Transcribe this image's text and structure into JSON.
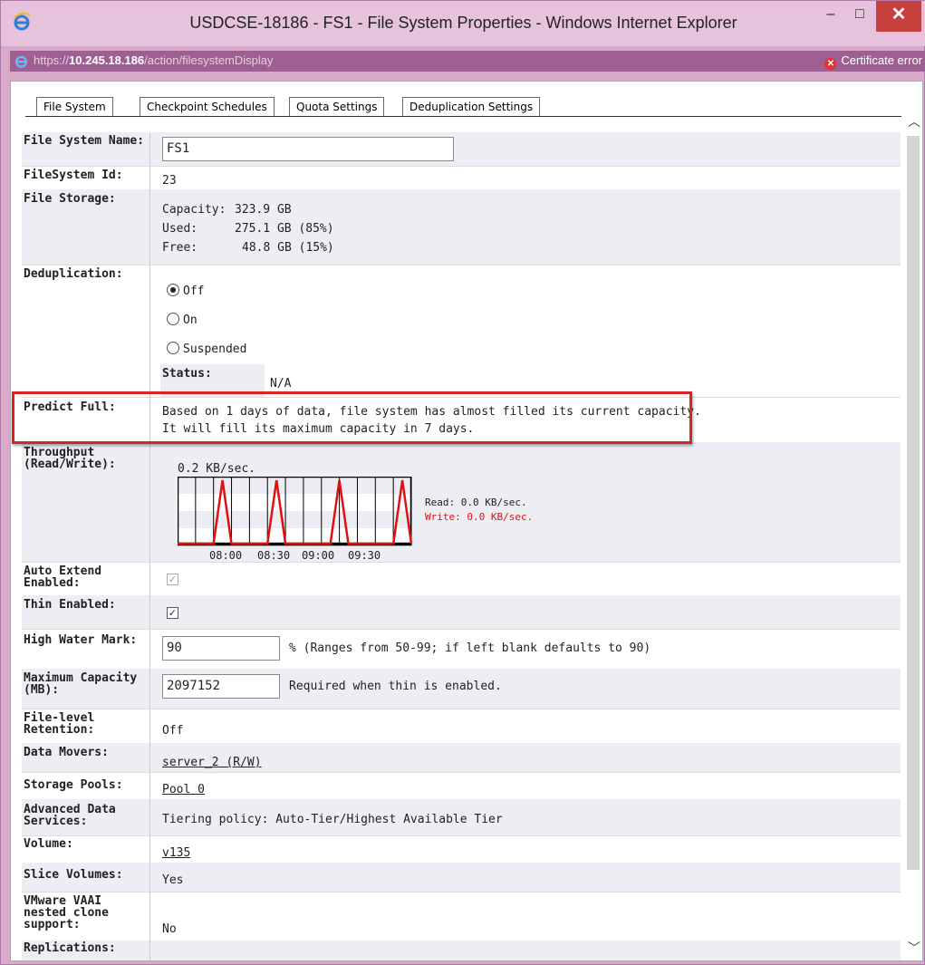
{
  "window": {
    "title": "USDCSE-18186 - FS1 - File System Properties - Windows Internet Explorer",
    "minimize": "–",
    "maximize": "□",
    "close": "✕"
  },
  "address": {
    "prefix": "https://",
    "host": "10.245.18.186",
    "path": "/action/filesystemDisplay",
    "cert_error": "Certificate error"
  },
  "tabs": [
    "File System",
    "Checkpoint Schedules",
    "Quota Settings",
    "Deduplication Settings"
  ],
  "fields": {
    "fs_name_label": "File System Name:",
    "fs_name_value": "FS1",
    "fs_id_label": "FileSystem Id:",
    "fs_id_value": "23",
    "storage_label": "File Storage:",
    "capacity_label": "Capacity:",
    "capacity_value": "323.9 GB",
    "used_label": "Used:",
    "used_value": "275.1 GB (85%)",
    "free_label": "Free:",
    "free_value": "48.8 GB (15%)",
    "dedup_label": "Deduplication:",
    "dedup_options": [
      "Off",
      "On",
      "Suspended"
    ],
    "dedup_selected": "Off",
    "status_label": "Status:",
    "status_value": "N/A",
    "predict_label": "Predict Full:",
    "predict_line1": "Based on 1 days of data, file system has almost filled its current capacity.",
    "predict_line2": "It will fill its maximum capacity in 7 days.",
    "throughput_label": "Throughput (Read/Write):",
    "throughput_value": "0.2 KB/sec.",
    "read_text": "Read:  0.0 KB/sec.",
    "write_text": "Write: 0.0 KB/sec.",
    "auto_extend_label": "Auto Extend Enabled:",
    "thin_label": "Thin Enabled:",
    "hwm_label": "High Water Mark:",
    "hwm_value": "90",
    "hwm_hint": "% (Ranges from 50-99; if left blank defaults to 90)",
    "maxcap_label": "Maximum Capacity (MB):",
    "maxcap_value": "2097152",
    "maxcap_hint": "Required when thin is enabled.",
    "retention_label": "File-level Retention:",
    "retention_value": "Off",
    "movers_label": "Data Movers:",
    "movers_value": "server_2 (R/W)",
    "pools_label": "Storage Pools:",
    "pools_value": "Pool 0",
    "ads_label": "Advanced Data Services:",
    "ads_value": "Tiering policy: Auto-Tier/Highest Available Tier",
    "volume_label": "Volume:",
    "volume_value": "v135",
    "slice_label": "Slice Volumes:",
    "slice_value": "Yes",
    "vaai_label": "VMware VAAI nested clone support:",
    "vaai_value": "No",
    "repl_label": "Replications:"
  },
  "chart_data": {
    "type": "line",
    "x_ticks": [
      "08:00",
      "08:30",
      "09:00",
      "09:30"
    ],
    "series": [
      {
        "name": "Read",
        "color": "#000000",
        "values": [
          0,
          0,
          0,
          0,
          0,
          0,
          0,
          0,
          0,
          0,
          0,
          0,
          0,
          0,
          0,
          0,
          0,
          0,
          0,
          0,
          0,
          0,
          0,
          0,
          0
        ]
      },
      {
        "name": "Write",
        "color": "#e01010",
        "values": [
          0,
          0,
          0,
          0,
          0,
          0.2,
          0,
          0,
          0,
          0,
          0,
          0.2,
          0,
          0,
          0,
          0,
          0,
          0,
          0.2,
          0,
          0,
          0,
          0,
          0,
          0,
          0.2,
          0
        ]
      }
    ]
  }
}
